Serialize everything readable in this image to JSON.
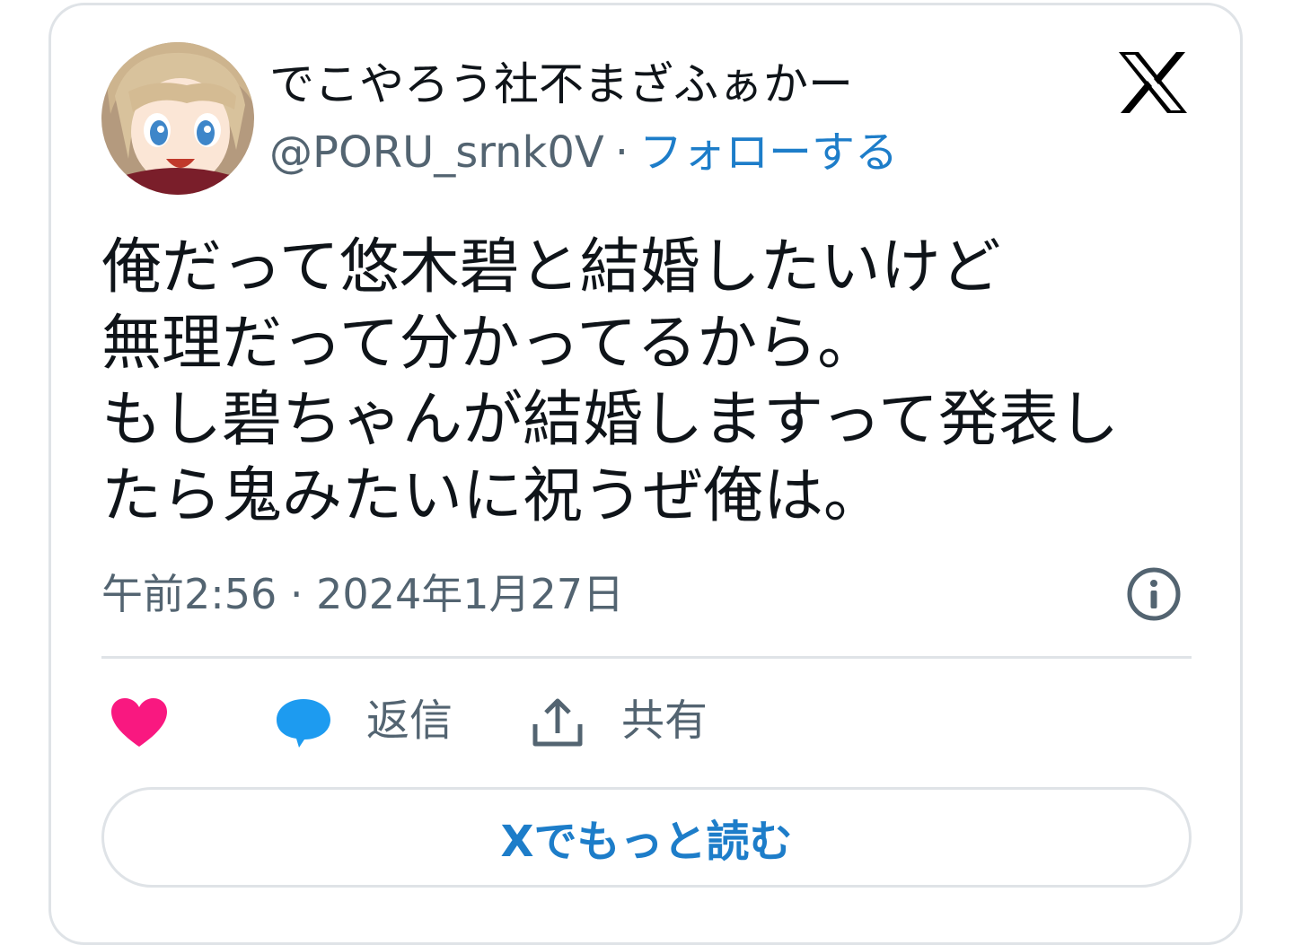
{
  "author": {
    "display_name": "でこやろう社不まざふぁかー",
    "handle": "@PORU_srnk0V",
    "separator": "·",
    "follow_label": "フォローする"
  },
  "tweet": {
    "lines": [
      "俺だって悠木碧と結婚したいけど",
      "無理だって分かってるから。",
      "もし碧ちゃんが結婚しますって発表し",
      "たら鬼みたいに祝うぜ俺は。"
    ],
    "timestamp": "午前2:56 · 2024年1月27日"
  },
  "actions": {
    "like_icon": "heart-icon",
    "reply_icon": "speech-bubble-icon",
    "reply_label": "返信",
    "share_icon": "share-upload-icon",
    "share_label": "共有"
  },
  "read_more_label": "Xでもっと読む",
  "colors": {
    "accent_blue": "#1d7dc9",
    "like_pink": "#f91880",
    "reply_blue": "#1d9bf0",
    "text_primary": "#0f1419",
    "text_secondary": "#536471",
    "border": "#dfe3e7"
  }
}
